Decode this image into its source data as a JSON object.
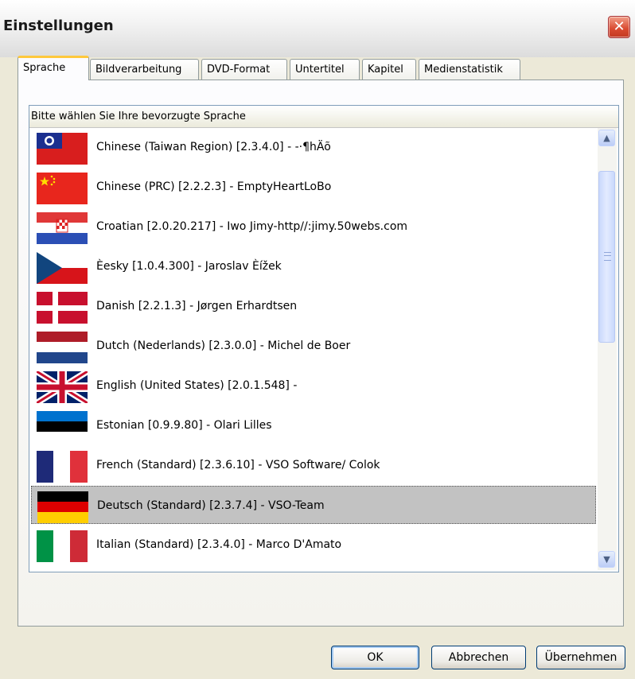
{
  "window": {
    "title": "Einstellungen",
    "close_label": "✕"
  },
  "tabs": [
    {
      "label": "Sprache",
      "active": true
    },
    {
      "label": "Bildverarbeitung",
      "active": false
    },
    {
      "label": "DVD-Format",
      "active": false
    },
    {
      "label": "Untertitel",
      "active": false
    },
    {
      "label": "Kapitel",
      "active": false
    },
    {
      "label": "Medienstatistik",
      "active": false
    }
  ],
  "language_list": {
    "header": "Bitte wählen Sie Ihre bevorzugte Sprache",
    "items": [
      {
        "label": "Chinese (Taiwan Region) [2.3.4.0] - -·¶hÄõ",
        "flag": "taiwan-flag-icon"
      },
      {
        "label": "Chinese (PRC) [2.2.2.3] - EmptyHeartLoBo",
        "flag": "china-flag-icon"
      },
      {
        "label": "Croatian [2.0.20.217] - Iwo Jimy-http//:jimy.50webs.com",
        "flag": "croatia-flag-icon"
      },
      {
        "label": "Èesky [1.0.4.300] - Jaroslav Èížek",
        "flag": "czech-flag-icon"
      },
      {
        "label": "Danish [2.2.1.3] - Jørgen Erhardtsen",
        "flag": "denmark-flag-icon"
      },
      {
        "label": "Dutch (Nederlands) [2.3.0.0] - Michel de Boer",
        "flag": "netherlands-flag-icon"
      },
      {
        "label": "English (United States) [2.0.1.548] -",
        "flag": "uk-flag-icon"
      },
      {
        "label": "Estonian [0.9.9.80] - Olari Lilles",
        "flag": "estonia-flag-icon"
      },
      {
        "label": "French (Standard) [2.3.6.10] - VSO Software/ Colok",
        "flag": "france-flag-icon"
      },
      {
        "label": "Deutsch (Standard) [2.3.7.4] - VSO-Team",
        "flag": "germany-flag-icon",
        "selected": true
      },
      {
        "label": "Italian (Standard) [2.3.4.0] - Marco D'Amato",
        "flag": "italy-flag-icon"
      }
    ],
    "scrollbar": {
      "up_icon": "scroll-up-arrow-icon",
      "down_icon": "scroll-down-arrow-icon"
    }
  },
  "buttons": {
    "ok": "OK",
    "cancel": "Abbrechen",
    "apply": "Übernehmen"
  },
  "colors": {
    "selection": "#c2c2c2",
    "tab_highlight": "#ffc83c",
    "dialog_bg": "#ece9d8"
  }
}
